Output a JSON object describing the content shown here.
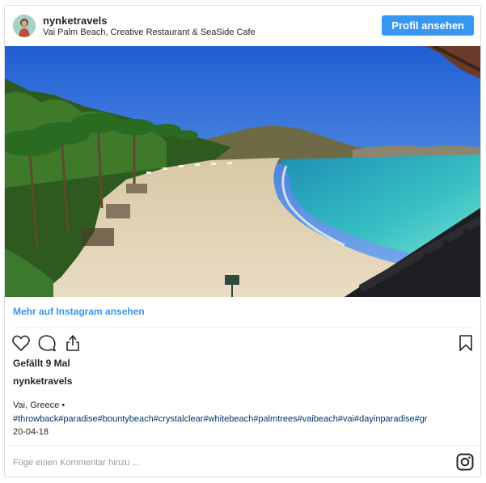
{
  "header": {
    "username": "nynketravels",
    "location": "Vai Palm Beach, Creative Restaurant & SeaSide Cafe",
    "profile_button": "Profil ansehen"
  },
  "post": {
    "more_link": "Mehr auf Instagram ansehen",
    "likes": "Gefällt 9 Mal",
    "caption_user": "nynketravels",
    "caption_location": "Vai, Greece •",
    "hashtags": [
      "#throwback",
      "#paradise",
      "#bountybeach",
      "#crystalclear",
      "#whitebeach",
      "#palmtrees",
      "#vaibeach",
      "#vai",
      "#dayinparadise",
      "#gr"
    ],
    "date": "20-04-18"
  },
  "comment": {
    "placeholder": "Füge einen Kommentar hinzu ..."
  },
  "colors": {
    "accent": "#3897f0",
    "hashtag": "#003569",
    "border": "#dbdbdb"
  },
  "icons": [
    "heart-icon",
    "comment-icon",
    "share-icon",
    "bookmark-icon",
    "instagram-icon"
  ]
}
